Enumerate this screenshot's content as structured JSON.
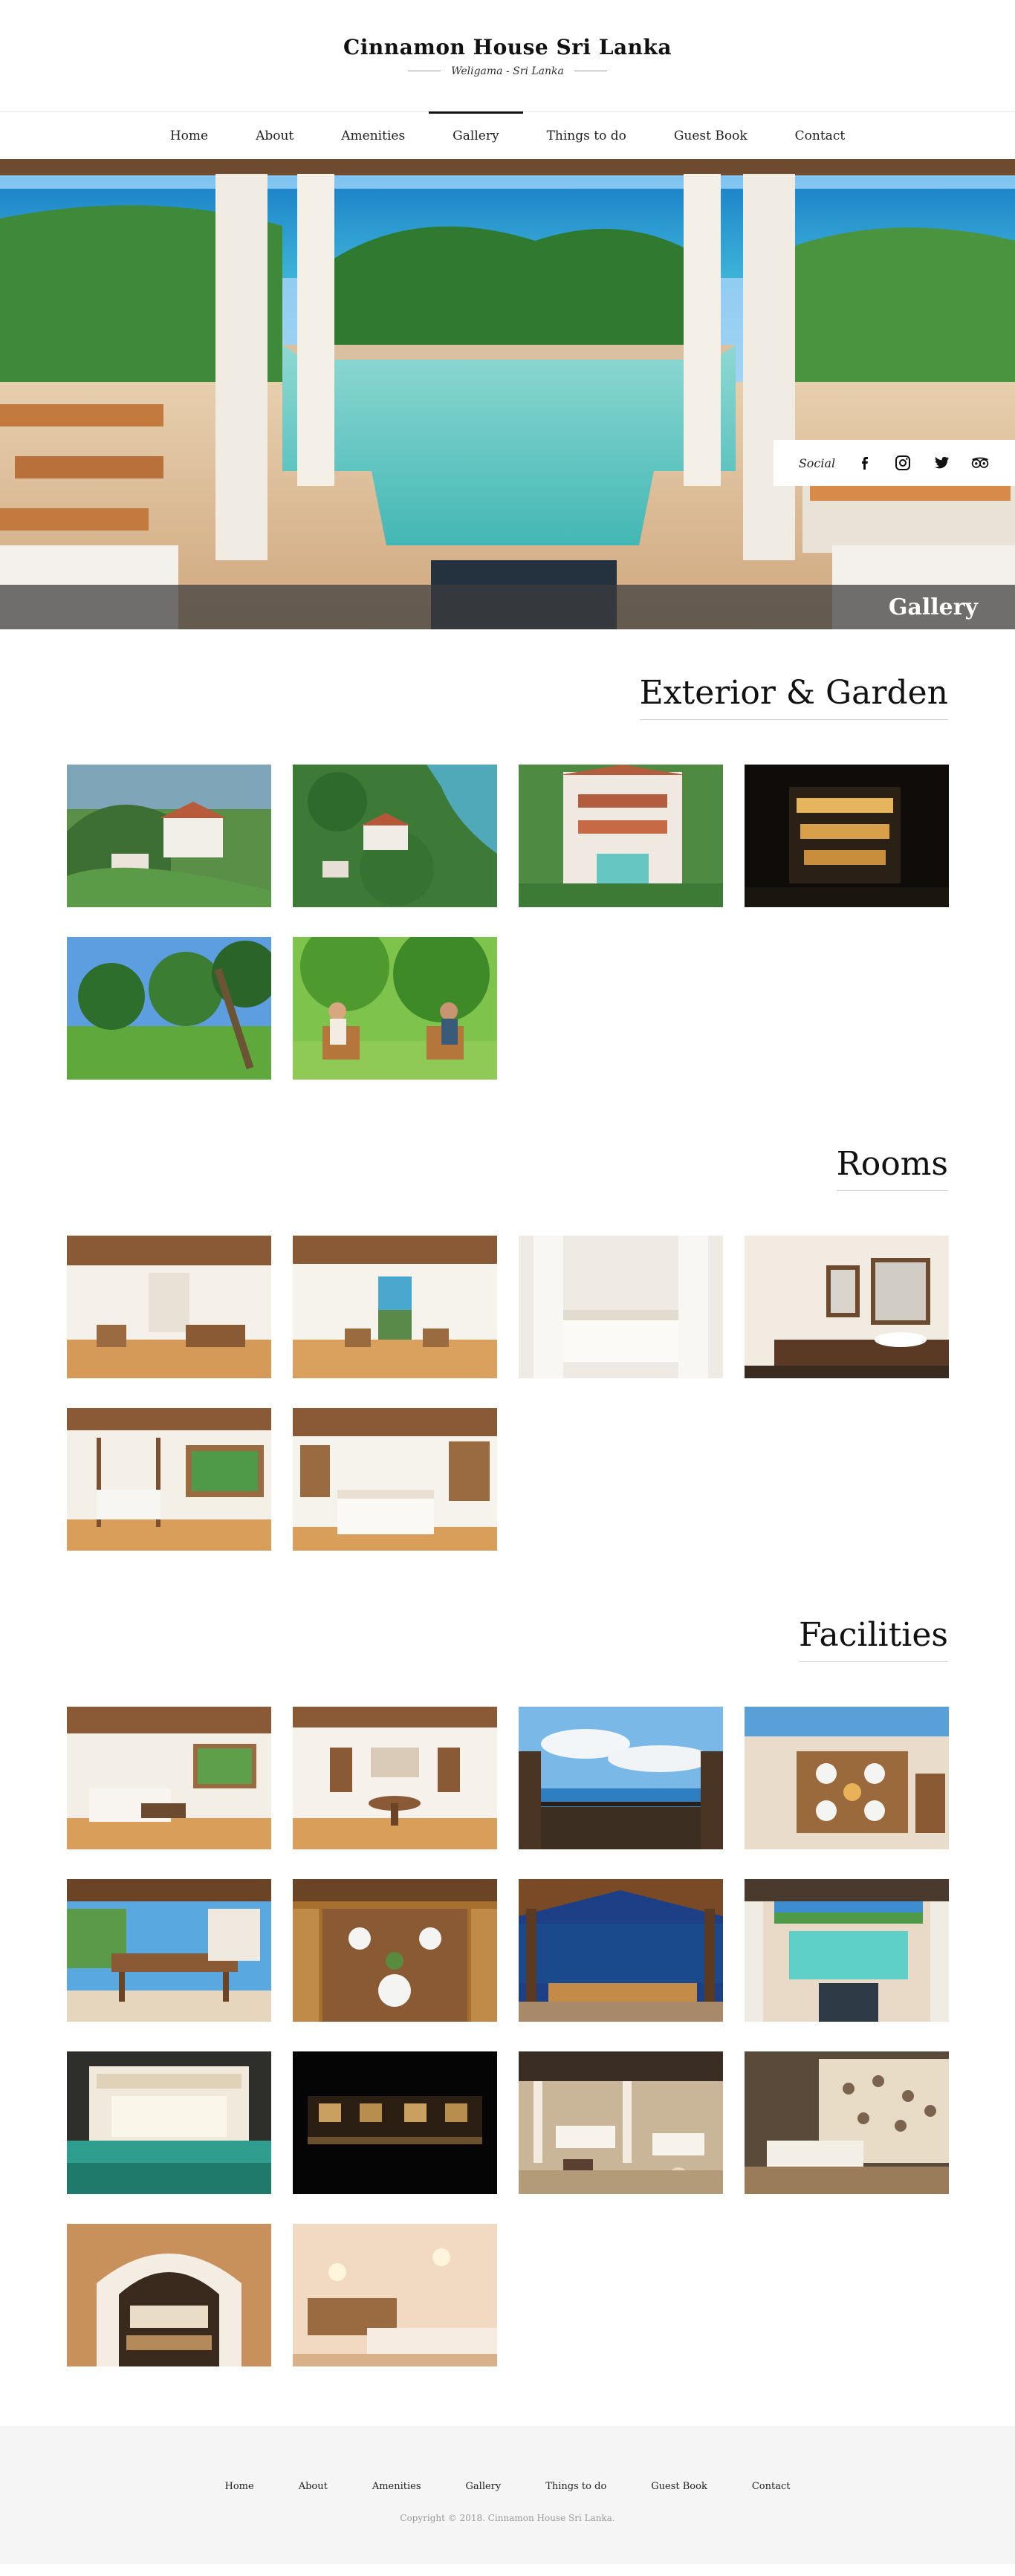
{
  "site": {
    "title": "Cinnamon House Sri Lanka",
    "subtitle": "Weligama - Sri Lanka"
  },
  "nav": {
    "items": [
      {
        "label": "Home"
      },
      {
        "label": "About"
      },
      {
        "label": "Amenities"
      },
      {
        "label": "Gallery"
      },
      {
        "label": "Things to do"
      },
      {
        "label": "Guest Book"
      },
      {
        "label": "Contact"
      }
    ],
    "active_index": 3
  },
  "hero": {
    "banner_title": "Gallery",
    "social": {
      "label": "Social",
      "icons": [
        "facebook-icon",
        "instagram-icon",
        "twitter-icon",
        "tripadvisor-icon"
      ]
    }
  },
  "sections": [
    {
      "title": "Exterior & Garden",
      "images": [
        "villa-on-cliff-aerial",
        "villa-in-forest-aerial",
        "villa-with-pool-aerial",
        "villa-lit-at-night",
        "garden-with-palm-trees",
        "couple-seated-in-garden"
      ]
    },
    {
      "title": "Rooms",
      "images": [
        "bedroom-with-ceiling-fan",
        "bedroom-with-sea-view",
        "white-canopy-bed",
        "bathroom-double-vanity",
        "four-poster-bed-room",
        "bedroom-with-wood-beams"
      ]
    },
    {
      "title": "Facilities",
      "images": [
        "living-room",
        "dining-corner",
        "sea-view-terrace",
        "table-set-on-terrace",
        "outdoor-dining-table",
        "dinner-table-setting",
        "pavilion-dining-at-dusk",
        "pool-terrace",
        "illuminated-pool-pavilion",
        "night-view-of-house",
        "lounge-with-lanterns",
        "patterned-light-wall",
        "arched-doorway-view",
        "massage-room"
      ]
    }
  ],
  "footer": {
    "nav": [
      "Home",
      "About",
      "Amenities",
      "Gallery",
      "Things to do",
      "Guest Book",
      "Contact"
    ],
    "copyright": "Copyright © 2018. Cinnamon House Sri Lanka."
  },
  "colors": {
    "banner_overlay": "#3c3c3c",
    "footer_bg": "#f5f5f5",
    "text": "#111111"
  }
}
